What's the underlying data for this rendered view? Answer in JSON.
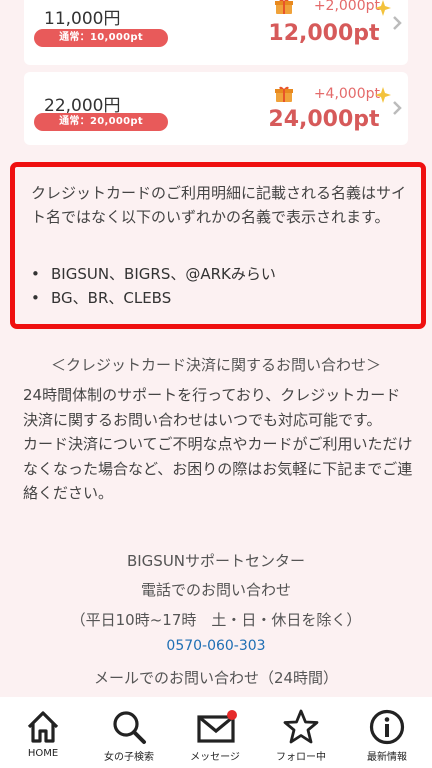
{
  "plans": [
    {
      "price": "11,000円",
      "regular": "通常：10,000pt",
      "bonus": "+2,000pt",
      "total": "12,000pt"
    },
    {
      "price": "22,000円",
      "regular": "通常：20,000pt",
      "bonus": "+4,000pt",
      "total": "24,000pt"
    }
  ],
  "notice": {
    "text": "クレジットカードのご利用明細に記載される名義はサイト名ではなく以下のいずれかの名義で表示されます。",
    "names": [
      "BIGSUN、BIGRS、@ARKみらい",
      "BG、BR、CLEBS"
    ],
    "border_color": "#ef1010"
  },
  "contact": {
    "title": "＜クレジットカード決済に関するお問い合わせ＞",
    "body": "24時間体制のサポートを行っており、クレジットカード決済に関するお問い合わせはいつでも対応可能です。\nカード決済についてご不明な点やカードがご利用いただけなくなった場合など、お困りの際はお気軽に下記までご連絡ください。",
    "center": "BIGSUNサポートセンター",
    "phone_label": "電話でのお問い合わせ",
    "hours": "（平日10時~17時　土・日・休日を除く）",
    "phone": "0570-060-303",
    "mail_label": "メールでのお問い合わせ（24時間）"
  },
  "tabs": [
    {
      "label": "HOME",
      "icon": "home-icon"
    },
    {
      "label": "女の子検索",
      "icon": "search-icon"
    },
    {
      "label": "メッセージ",
      "icon": "mail-icon"
    },
    {
      "label": "フォロー中",
      "icon": "star-icon"
    },
    {
      "label": "最新情報",
      "icon": "info-icon"
    }
  ],
  "colors": {
    "accent": "#e85a5a",
    "total": "#d65a5a",
    "phone": "#1f6fb4",
    "background": "#fcf1f2"
  }
}
